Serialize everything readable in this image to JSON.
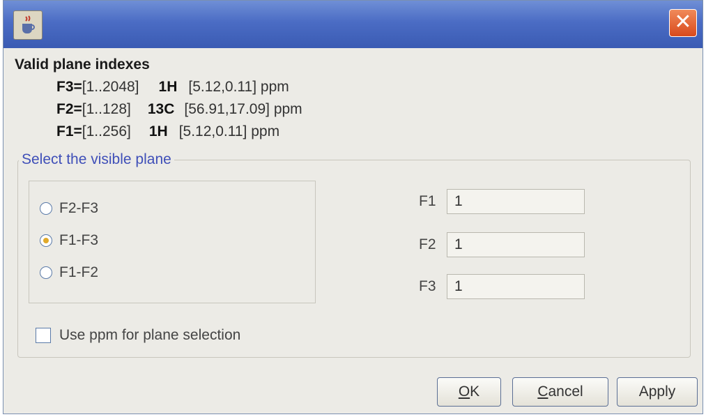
{
  "window": {
    "title": ""
  },
  "icons": {
    "app": "java-cup-icon",
    "close": "close-icon"
  },
  "close_glyph": "✕",
  "valid": {
    "title": "Valid plane indexes",
    "rows": [
      {
        "axis": "F3=",
        "range": "[1..2048]",
        "nucleus": "1H",
        "ppm": "[5.12,0.11] ppm"
      },
      {
        "axis": "F2=",
        "range": "[1..128]",
        "nucleus": "13C",
        "ppm": "[56.91,17.09] ppm"
      },
      {
        "axis": "F1=",
        "range": "[1..256]",
        "nucleus": "1H",
        "ppm": "[5.12,0.11] ppm"
      }
    ]
  },
  "plane_group": {
    "legend": "Select the visible plane",
    "options": [
      {
        "label": "F2-F3",
        "selected": false
      },
      {
        "label": "F1-F3",
        "selected": true
      },
      {
        "label": "F1-F2",
        "selected": false
      }
    ]
  },
  "fields": [
    {
      "label": "F1",
      "value": "1"
    },
    {
      "label": "F2",
      "value": "1"
    },
    {
      "label": "F3",
      "value": "1"
    }
  ],
  "ppm_checkbox": {
    "label": "Use ppm for plane selection",
    "checked": false
  },
  "buttons": {
    "ok": {
      "mnemonic": "O",
      "rest": "K"
    },
    "cancel": {
      "mnemonic": "C",
      "rest": "ancel"
    },
    "apply": {
      "label": "Apply"
    }
  },
  "colors": {
    "titlebar": "#4b6cc4",
    "legend_text": "#3f4fb8",
    "close_button": "#d94a1c",
    "radio_dot": "#e0a92a"
  }
}
